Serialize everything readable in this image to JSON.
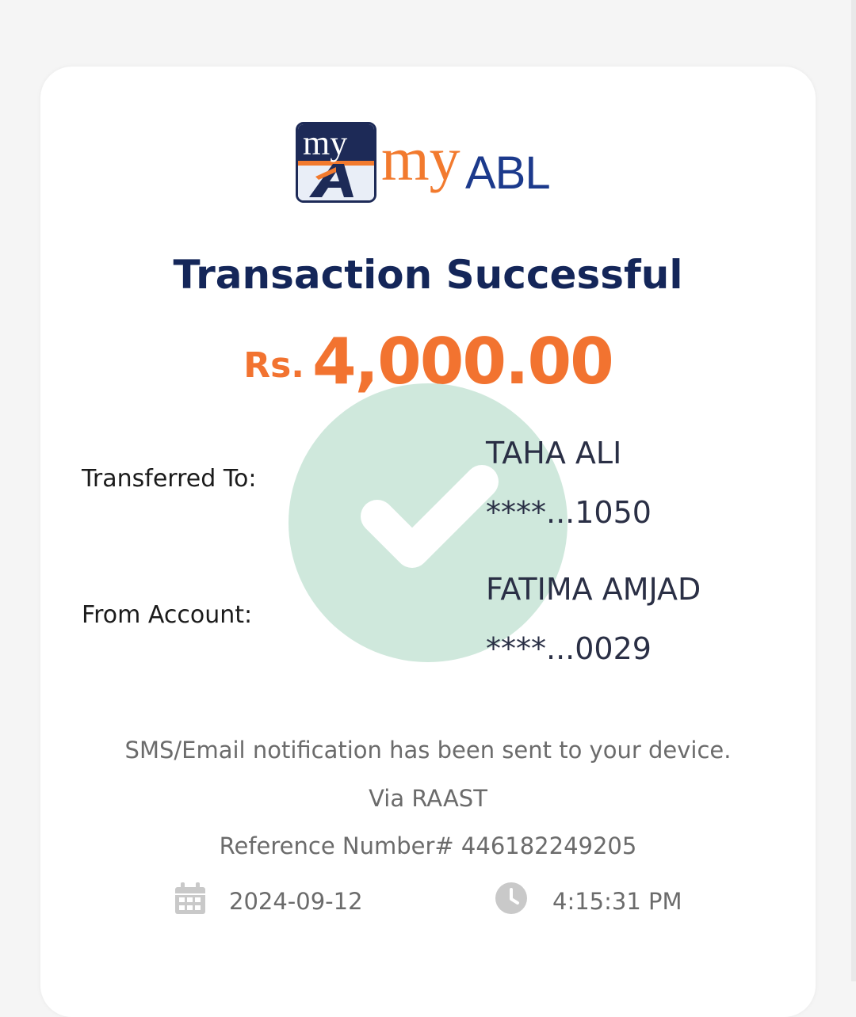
{
  "brand": {
    "badge_text": "my",
    "logo_my": "my",
    "logo_abl": "ABL"
  },
  "receipt": {
    "title": "Transaction Successful",
    "currency": "Rs.",
    "amount": "4,000.00",
    "transferred_to_label": "Transferred To:",
    "transferred_to_name": "TAHA ALI",
    "transferred_to_account": "****...1050",
    "from_account_label": "From Account:",
    "from_account_name": "FATIMA AMJAD",
    "from_account_number": "****...0029",
    "notification": "SMS/Email notification has been sent to your device.",
    "channel": "Via RAAST",
    "reference": "Reference Number# 446182249205",
    "date": "2024-09-12",
    "time": "4:15:31 PM"
  },
  "colors": {
    "title_navy": "#142659",
    "amount_orange": "#f27330",
    "check_green": "#cfe8dc"
  },
  "icons": {
    "date": "calendar-icon",
    "time": "clock-icon",
    "status": "checkmark-icon"
  }
}
